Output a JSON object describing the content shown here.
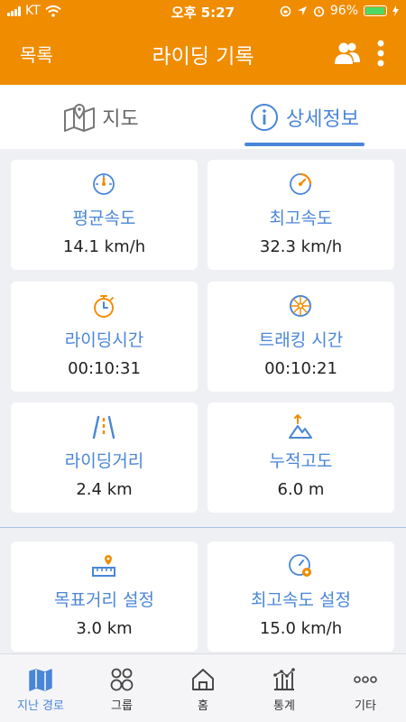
{
  "status": {
    "carrier": "KT",
    "time": "오후 5:27",
    "battery": "96%",
    "battery_fraction": 0.96
  },
  "app_bar": {
    "back_label": "목록",
    "title": "라이딩 기록"
  },
  "tabs": [
    {
      "label": "지도",
      "icon": "map-icon",
      "active": false
    },
    {
      "label": "상세정보",
      "icon": "info-icon",
      "active": true
    }
  ],
  "stats": [
    {
      "icon": "speedometer-icon",
      "label": "평균속도",
      "value": "14.1 km/h"
    },
    {
      "icon": "speedometer-max-icon",
      "label": "최고속도",
      "value": "32.3 km/h"
    },
    {
      "icon": "stopwatch-icon",
      "label": "라이딩시간",
      "value": "00:10:31"
    },
    {
      "icon": "wheel-icon",
      "label": "트래킹 시간",
      "value": "00:10:21"
    },
    {
      "icon": "road-icon",
      "label": "라이딩거리",
      "value": "2.4 km"
    },
    {
      "icon": "mountain-icon",
      "label": "누적고도",
      "value": "6.0 m"
    }
  ],
  "settings": [
    {
      "icon": "goal-distance-icon",
      "label": "목표거리 설정",
      "value": "3.0 km"
    },
    {
      "icon": "speed-setting-icon",
      "label": "최고속도 설정",
      "value": "15.0 km/h"
    }
  ],
  "nav": [
    {
      "label": "지난 경로",
      "icon": "map-icon",
      "active": true
    },
    {
      "label": "그룹",
      "icon": "group-icon",
      "active": false
    },
    {
      "label": "홈",
      "icon": "home-icon",
      "active": false
    },
    {
      "label": "통계",
      "icon": "stats-icon",
      "active": false
    },
    {
      "label": "기타",
      "icon": "more-icon",
      "active": false
    }
  ],
  "colors": {
    "accent": "#f08c00",
    "primary": "#4a86d8",
    "background": "#eef0f4"
  }
}
